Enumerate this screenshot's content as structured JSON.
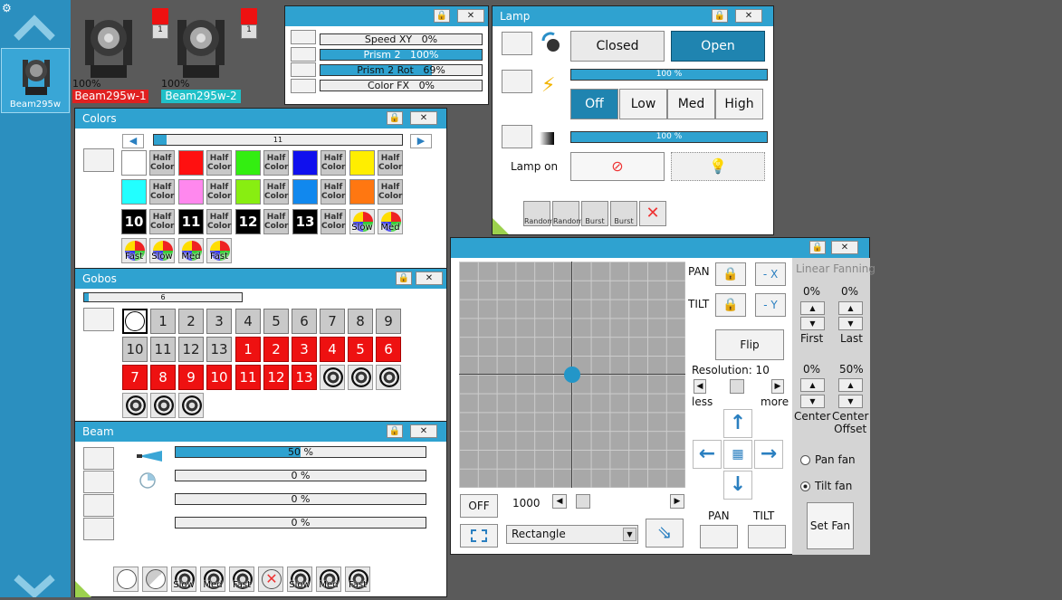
{
  "sidebar": {
    "fixture_label": "Beam295w"
  },
  "fixtures": [
    {
      "name": "Beam295w-1",
      "pct": "100%",
      "channel": "1",
      "color": "#e02020"
    },
    {
      "name": "Beam295w-2",
      "pct": "100%",
      "channel": "1",
      "color": "#20c0c8"
    }
  ],
  "speed_window": {
    "rows": [
      {
        "label": "Speed XY",
        "value": "0%",
        "fill": 0
      },
      {
        "label": "Prism 2",
        "value": "100%",
        "fill": 1
      },
      {
        "label": "Prism 2 Rot",
        "value": "69%",
        "fill": 0.69
      },
      {
        "label": "Color FX",
        "value": "0%",
        "fill": 0
      }
    ]
  },
  "lamp": {
    "title": "Lamp",
    "closed": "Closed",
    "open": "Open",
    "bar1": "100 %",
    "bar2": "100 %",
    "off": "Off",
    "low": "Low",
    "med": "Med",
    "high": "High",
    "lamp_on": "Lamp on",
    "fx": [
      "Random",
      "Random",
      "Burst",
      "Burst",
      ""
    ]
  },
  "colors": {
    "title": "Colors",
    "slider_value": "11",
    "half": "Half Color",
    "row1": [
      "#ffffff",
      "#ff1010",
      "#33ee11",
      "#1010ee",
      "#ffee00"
    ],
    "row2": [
      "#22ffff",
      "#ff88ee",
      "#88ee11",
      "#1188ee",
      "#ff7711"
    ],
    "nums": [
      "10",
      "11",
      "12",
      "13"
    ],
    "wheels_r3": [
      "Slow",
      "Med"
    ],
    "wheels_r4": [
      "Fast",
      "Slow",
      "Med",
      "Fast"
    ]
  },
  "gobos": {
    "title": "Gobos",
    "slider_value": "6",
    "row1": [
      "1",
      "2",
      "3",
      "4",
      "5",
      "6",
      "7",
      "8",
      "9"
    ],
    "row2_gray": [
      "10",
      "11",
      "12",
      "13"
    ],
    "row2_red": [
      "1",
      "2",
      "3",
      "4",
      "5",
      "6"
    ],
    "row3_red": [
      "7",
      "8",
      "9",
      "10",
      "11",
      "12",
      "13"
    ]
  },
  "beam": {
    "title": "Beam",
    "bars": [
      {
        "value": "50 %",
        "fill": 0.5
      },
      {
        "value": "0 %",
        "fill": 0
      },
      {
        "value": "0 %",
        "fill": 0
      },
      {
        "value": "0 %",
        "fill": 0
      }
    ],
    "fx": [
      "",
      "",
      "Slow",
      "Med",
      "Fast",
      "",
      "Slow",
      "Med",
      "Fast"
    ]
  },
  "pantilt": {
    "pan": "PAN",
    "tilt": "TILT",
    "minus_x": "- X",
    "minus_y": "- Y",
    "flip": "Flip",
    "resolution": "Resolution: 10",
    "less": "less",
    "more": "more",
    "off": "OFF",
    "speed": "1000",
    "shape": "Rectangle",
    "pan_btn": "PAN",
    "tilt_btn": "TILT",
    "linear_fanning": "Linear Fanning",
    "first_val": "0%",
    "last_val": "0%",
    "first": "First",
    "last": "Last",
    "center_val": "0%",
    "offset_val": "50%",
    "center": "Center",
    "center_offset": "Center\nOffset",
    "pan_fan": "Pan fan",
    "tilt_fan": "Tilt fan",
    "set_fan": "Set Fan",
    "point_x": 0,
    "point_y": 0
  }
}
